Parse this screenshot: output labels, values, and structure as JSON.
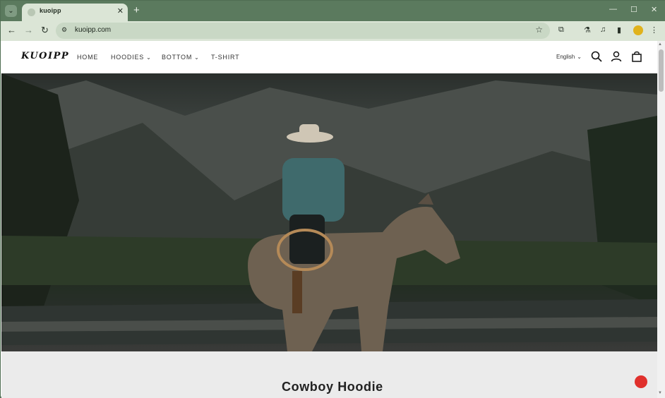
{
  "browser": {
    "tab_title": "kuoipp",
    "url": "kuoipp.com"
  },
  "site": {
    "logo": "KUOIPP",
    "nav": [
      {
        "label": "HOME"
      },
      {
        "label": "HOODIES"
      },
      {
        "label": "BOTTOM"
      },
      {
        "label": "T-SHIRT"
      }
    ],
    "language": "English"
  },
  "hero": {
    "image_alt": "Cowboy on horseback by a river with mountains"
  },
  "product": {
    "title": "Cowboy Hoodie"
  },
  "colors": {
    "browser_frame": "#5b7a5e",
    "toolbar": "#dbe5d6",
    "chat_button": "#e0302c"
  },
  "icons": {
    "search": "search-icon",
    "account": "account-icon",
    "cart": "cart-icon"
  }
}
